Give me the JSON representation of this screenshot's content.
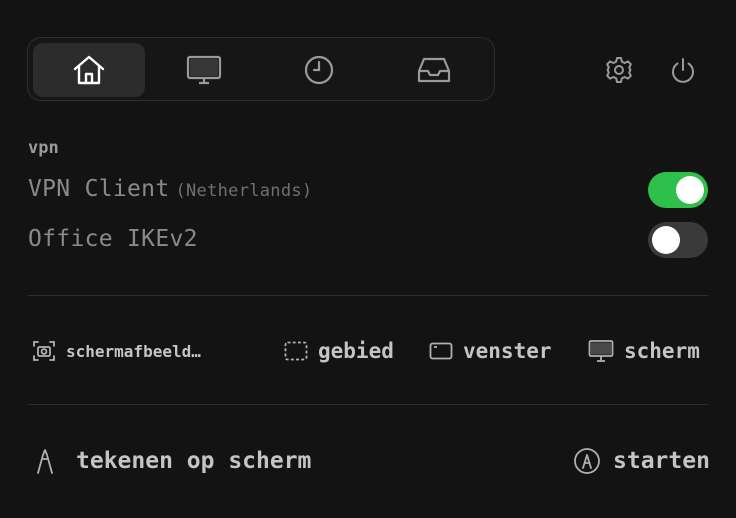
{
  "tabs": [
    {
      "icon": "home-icon",
      "active": true
    },
    {
      "icon": "monitor-icon",
      "active": false
    },
    {
      "icon": "clock-icon",
      "active": false
    },
    {
      "icon": "inbox-icon",
      "active": false
    }
  ],
  "top_actions": [
    {
      "icon": "gear-icon"
    },
    {
      "icon": "power-icon"
    }
  ],
  "vpn": {
    "section_title": "vpn",
    "items": [
      {
        "name": "VPN Client",
        "detail": "(Netherlands)",
        "enabled": true
      },
      {
        "name": "Office IKEv2",
        "detail": "",
        "enabled": false
      }
    ]
  },
  "screenshot": {
    "items": [
      {
        "icon": "camera-icon",
        "label": "schermafbeeld…"
      },
      {
        "icon": "region-select-icon",
        "label": "gebied"
      },
      {
        "icon": "window-icon",
        "label": "venster"
      },
      {
        "icon": "monitor-icon",
        "label": "scherm"
      }
    ]
  },
  "draw": {
    "label": "tekenen op scherm",
    "action_label": "starten",
    "icons": {
      "pen": "pen-icon",
      "start": "start-icon"
    }
  },
  "colors": {
    "accent_green": "#2fc04b",
    "background": "#131313"
  }
}
